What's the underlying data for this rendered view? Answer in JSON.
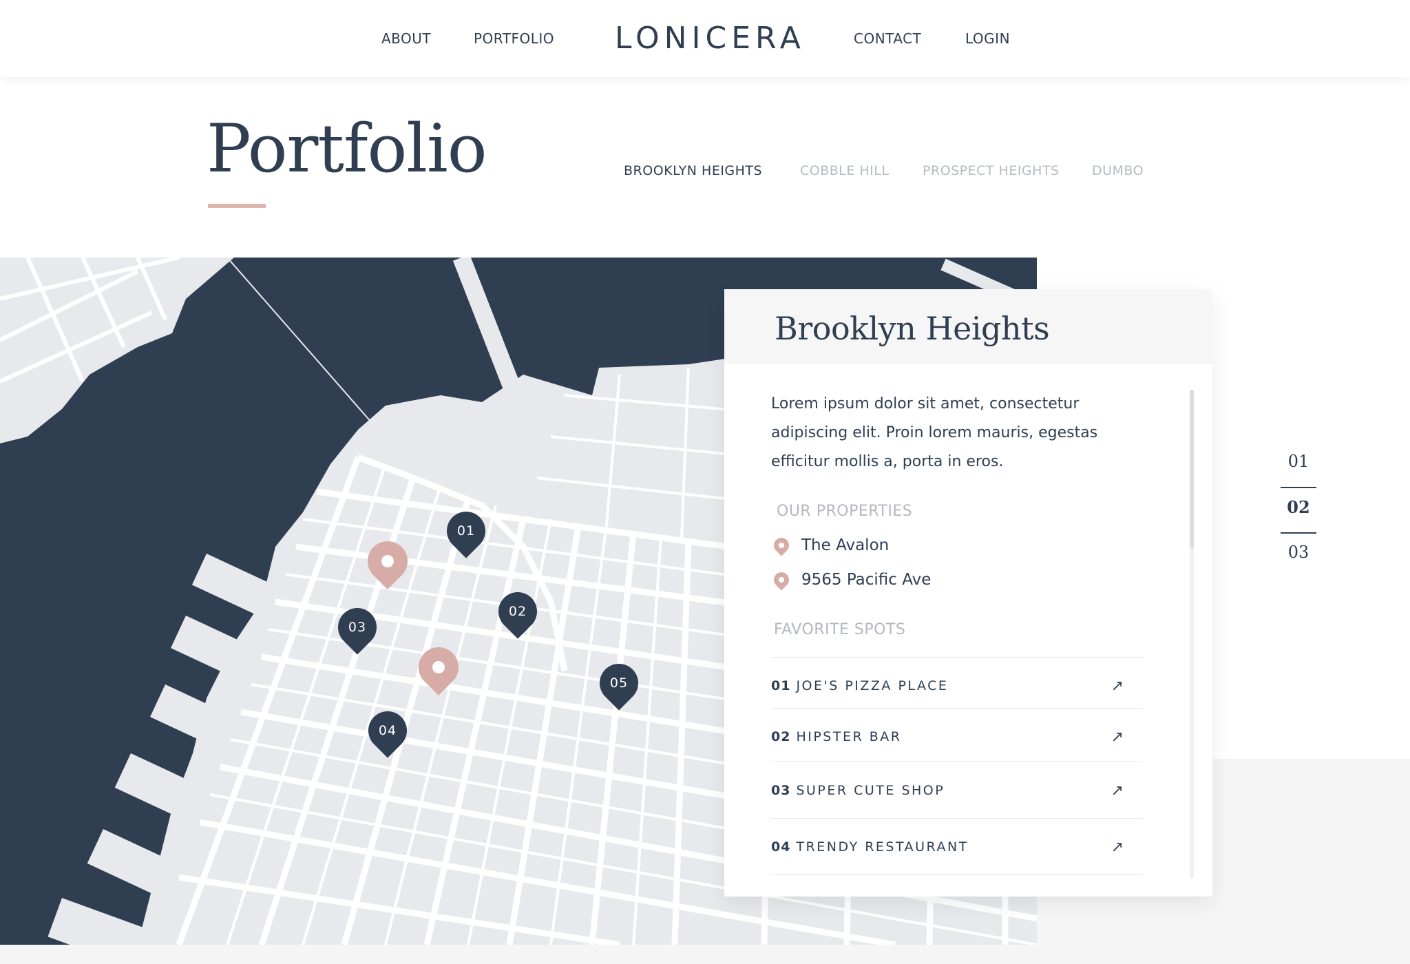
{
  "nav": {
    "about": "ABOUT",
    "portfolio": "PORTFOLIO",
    "logo": "LONICERA",
    "contact": "CONTACT",
    "login": "LOGIN"
  },
  "page": {
    "title": "Portfolio",
    "tabs": [
      {
        "label": "BROOKLYN HEIGHTS",
        "active": true
      },
      {
        "label": "COBBLE HILL",
        "active": false
      },
      {
        "label": "PROSPECT HEIGHTS",
        "active": false
      },
      {
        "label": "DUMBO",
        "active": false
      }
    ]
  },
  "map": {
    "pins": [
      "01",
      "02",
      "03",
      "04",
      "05"
    ],
    "colors": {
      "water": "#2f3e51",
      "land": "#e8e9ed",
      "streets": "#ffffff",
      "accent": "#d8aca6"
    }
  },
  "card": {
    "title": "Brooklyn Heights",
    "description": "Lorem ipsum dolor sit amet, consectetur adipiscing elit. Proin lorem mauris, egestas efficitur mollis a, porta in eros.",
    "properties_label": "OUR PROPERTIES",
    "properties": [
      "The Avalon",
      "9565 Pacific Ave"
    ],
    "spots_label": "FAVORITE SPOTS",
    "spots": [
      {
        "num": "01",
        "name": "JOE'S PIZZA PLACE"
      },
      {
        "num": "02",
        "name": "HIPSTER BAR"
      },
      {
        "num": "03",
        "name": "SUPER CUTE SHOP"
      },
      {
        "num": "04",
        "name": "TRENDY RESTAURANT"
      }
    ],
    "arrow_icon": "arrow-up-right-icon"
  },
  "pager": {
    "items": [
      "01",
      "02",
      "03"
    ],
    "active": "02"
  }
}
